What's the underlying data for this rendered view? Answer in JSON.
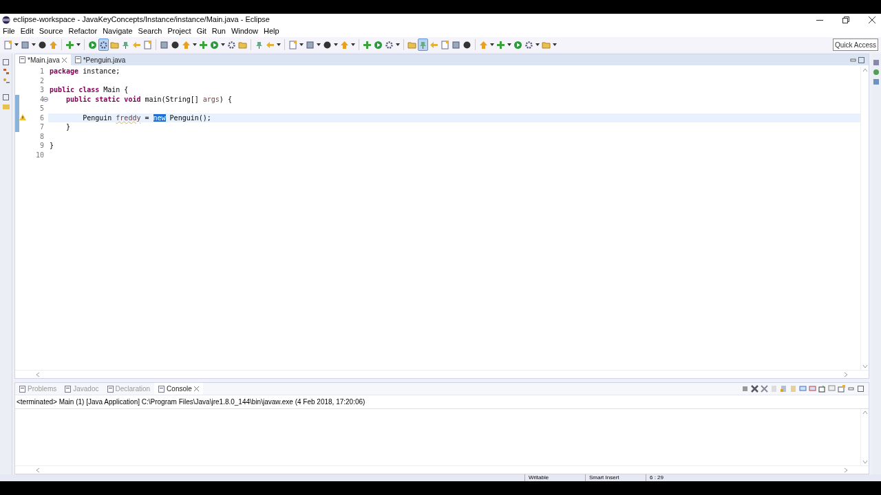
{
  "window": {
    "title": "eclipse-workspace - JavaKeyConcepts/Instance/instance/Main.java - Eclipse"
  },
  "menu": [
    "File",
    "Edit",
    "Source",
    "Refactor",
    "Navigate",
    "Search",
    "Project",
    "Git",
    "Run",
    "Window",
    "Help"
  ],
  "toolbar": [
    {
      "kind": "dropdown",
      "selected": false
    },
    {
      "kind": "dropdown",
      "selected": false
    },
    {
      "kind": "button",
      "selected": false
    },
    {
      "kind": "button",
      "selected": false
    },
    {
      "kind": "separator"
    },
    {
      "kind": "dropdown",
      "selected": false
    },
    {
      "kind": "separator"
    },
    {
      "kind": "button",
      "selected": false
    },
    {
      "kind": "button",
      "selected": true
    },
    {
      "kind": "button",
      "selected": false
    },
    {
      "kind": "button",
      "selected": false
    },
    {
      "kind": "button",
      "selected": false
    },
    {
      "kind": "button",
      "selected": false
    },
    {
      "kind": "separator"
    },
    {
      "kind": "button",
      "selected": false
    },
    {
      "kind": "button",
      "selected": false
    },
    {
      "kind": "dropdown",
      "selected": false
    },
    {
      "kind": "button",
      "selected": false
    },
    {
      "kind": "dropdown",
      "selected": false
    },
    {
      "kind": "button",
      "selected": false
    },
    {
      "kind": "button",
      "selected": false
    },
    {
      "kind": "separator"
    },
    {
      "kind": "button",
      "selected": false
    },
    {
      "kind": "dropdown",
      "selected": false
    },
    {
      "kind": "separator"
    },
    {
      "kind": "dropdown",
      "selected": false
    },
    {
      "kind": "dropdown",
      "selected": false
    },
    {
      "kind": "dropdown",
      "selected": false
    },
    {
      "kind": "dropdown",
      "selected": false
    },
    {
      "kind": "separator"
    },
    {
      "kind": "button",
      "selected": false
    },
    {
      "kind": "button",
      "selected": false
    },
    {
      "kind": "dropdown",
      "selected": false
    },
    {
      "kind": "separator"
    },
    {
      "kind": "button",
      "selected": false
    },
    {
      "kind": "button",
      "selected": true
    },
    {
      "kind": "button",
      "selected": false
    },
    {
      "kind": "button",
      "selected": false
    },
    {
      "kind": "button",
      "selected": false
    },
    {
      "kind": "button",
      "selected": false
    },
    {
      "kind": "separator"
    },
    {
      "kind": "dropdown",
      "selected": false
    },
    {
      "kind": "dropdown",
      "selected": false
    },
    {
      "kind": "button",
      "selected": false
    },
    {
      "kind": "dropdown",
      "selected": false
    },
    {
      "kind": "dropdown",
      "selected": false
    }
  ],
  "quick_access": {
    "placeholder": "Quick Access"
  },
  "editor": {
    "tabs": [
      {
        "label": "*Main.java",
        "selected": true,
        "closable": true
      },
      {
        "label": "*Penguin.java",
        "selected": false,
        "closable": false
      }
    ],
    "lines": [
      {
        "number": "1",
        "tokens": [
          {
            "kind": "keyword",
            "text": "package"
          },
          {
            "kind": "plain",
            "text": " instance;"
          }
        ]
      },
      {
        "number": "2"
      },
      {
        "number": "3",
        "tokens": [
          {
            "kind": "keyword",
            "text": "public class"
          },
          {
            "kind": "plain",
            "text": " Main {"
          }
        ]
      },
      {
        "number": "4",
        "fold": true,
        "scope": true,
        "tokens": [
          {
            "kind": "keyword",
            "text": "    public static void"
          },
          {
            "kind": "plain",
            "text": " main(String[] "
          },
          {
            "kind": "param",
            "text": "args"
          },
          {
            "kind": "plain",
            "text": ") {"
          }
        ]
      },
      {
        "number": "5",
        "scope": true
      },
      {
        "number": "6",
        "scope": true,
        "current": true,
        "warning": true,
        "tokens": [
          {
            "kind": "plain",
            "text": "        Penguin "
          },
          {
            "kind": "unused",
            "text": "freddy"
          },
          {
            "kind": "plain",
            "text": " = "
          },
          {
            "kind": "selected",
            "text": "new"
          },
          {
            "kind": "plain",
            "text": " Penguin();"
          }
        ]
      },
      {
        "number": "7",
        "scope": true,
        "tokens": [
          {
            "kind": "plain",
            "text": "    }"
          }
        ]
      },
      {
        "number": "8"
      },
      {
        "number": "9",
        "tokens": [
          {
            "kind": "plain",
            "text": "}"
          }
        ]
      },
      {
        "number": "10"
      }
    ]
  },
  "bottom_panel": {
    "tabs": [
      {
        "label": "Problems",
        "selected": false,
        "closable": false
      },
      {
        "label": "Javadoc",
        "selected": false,
        "closable": false
      },
      {
        "label": "Declaration",
        "selected": false,
        "closable": false
      },
      {
        "label": "Console",
        "selected": true,
        "closable": true
      }
    ],
    "console_header": "<terminated> Main (1) [Java Application] C:\\Program Files\\Java\\jre1.8.0_144\\bin\\javaw.exe (4 Feb 2018, 17:20:06)"
  },
  "status_bar": [
    "Writable",
    "Smart Insert",
    "6 : 29"
  ]
}
